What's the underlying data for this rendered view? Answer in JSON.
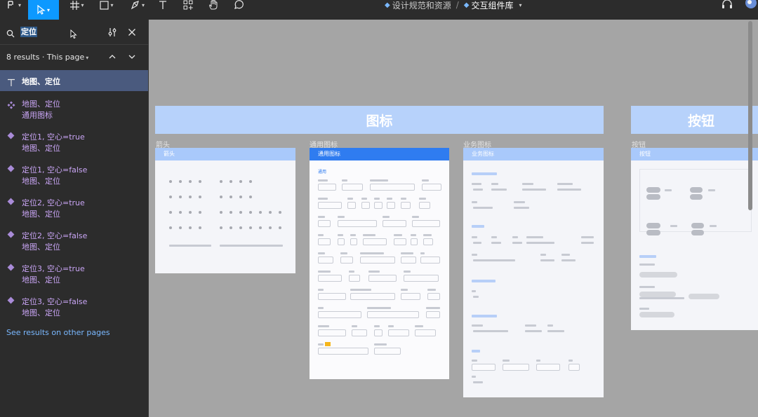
{
  "toolbar": {
    "tools": [
      {
        "name": "main-menu",
        "icon": "figma-menu-icon",
        "active": false
      },
      {
        "name": "move-tool",
        "icon": "cursor-arrow-icon",
        "active": true
      },
      {
        "name": "frame-tool",
        "icon": "frame-hash-icon",
        "active": false
      },
      {
        "name": "shape-tool",
        "icon": "rectangle-icon",
        "active": false
      },
      {
        "name": "pen-tool",
        "icon": "pen-icon",
        "active": false
      },
      {
        "name": "text-tool",
        "icon": "text-t-icon",
        "active": false
      },
      {
        "name": "resources-tool",
        "icon": "components-icon",
        "active": false
      },
      {
        "name": "hand-tool",
        "icon": "hand-icon",
        "active": false
      },
      {
        "name": "comment-tool",
        "icon": "comment-bubble-icon",
        "active": false
      }
    ],
    "breadcrumb_team": "设计规范和资源",
    "breadcrumb_file": "交互组件库",
    "accent_color": "#0d99ff"
  },
  "search": {
    "query": "定位",
    "results_label": "8 results · This page",
    "see_other_label": "See results on other pages"
  },
  "results": [
    {
      "icon": "text-layer-icon",
      "title": "地图、定位",
      "subtitle": "",
      "selected": true
    },
    {
      "icon": "component-icon",
      "title": "地图、定位",
      "subtitle": "通用图标",
      "selected": false
    },
    {
      "icon": "instance-diamond-icon",
      "title": "定位1, 空心=true",
      "subtitle": "地图、定位",
      "selected": false
    },
    {
      "icon": "instance-diamond-icon",
      "title": "定位1, 空心=false",
      "subtitle": "地图、定位",
      "selected": false
    },
    {
      "icon": "instance-diamond-icon",
      "title": "定位2, 空心=true",
      "subtitle": "地图、定位",
      "selected": false
    },
    {
      "icon": "instance-diamond-icon",
      "title": "定位2, 空心=false",
      "subtitle": "地图、定位",
      "selected": false
    },
    {
      "icon": "instance-diamond-icon",
      "title": "定位3, 空心=true",
      "subtitle": "地图、定位",
      "selected": false
    },
    {
      "icon": "instance-diamond-icon",
      "title": "定位3, 空心=false",
      "subtitle": "地图、定位",
      "selected": false
    }
  ],
  "canvas": {
    "sections": [
      {
        "title": "图标"
      },
      {
        "title": "按钮"
      }
    ],
    "frames": [
      {
        "label": "箭头",
        "header": "箭头"
      },
      {
        "label": "通用图标",
        "header": "通用图标",
        "subheading": "通用"
      },
      {
        "label": "业务图标",
        "header": "业务图标"
      },
      {
        "label": "按钮",
        "header": "按钮"
      }
    ]
  }
}
